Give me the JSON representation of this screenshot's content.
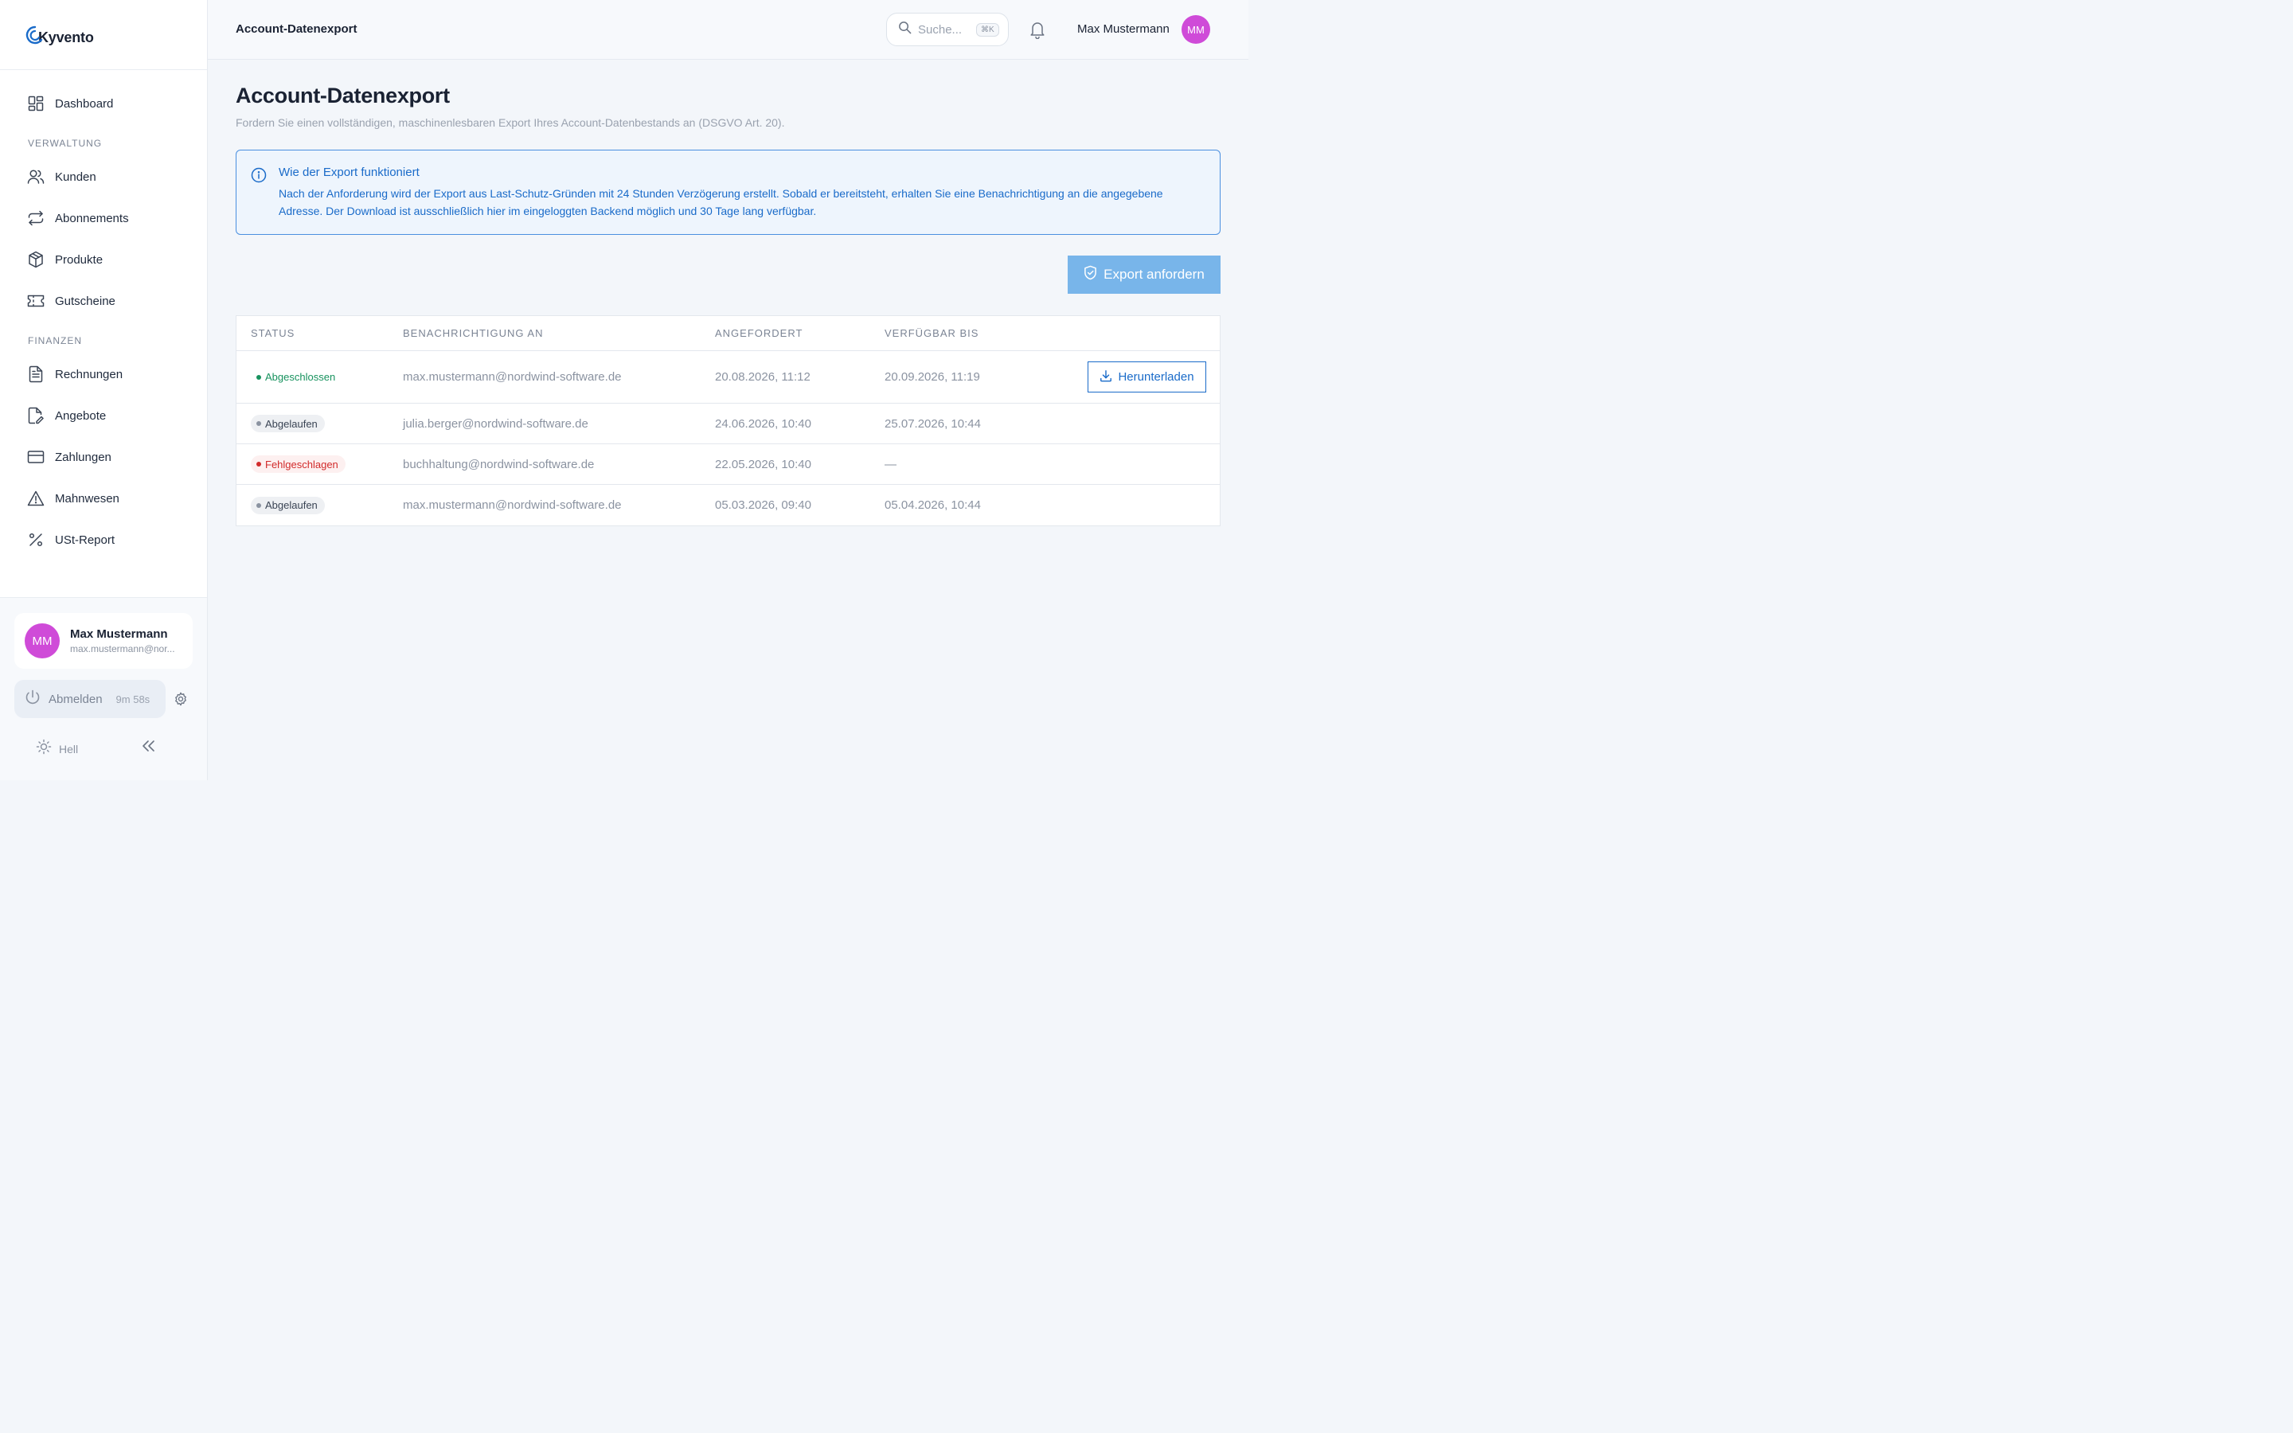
{
  "app": {
    "brand": "Kyvento"
  },
  "sidebar": {
    "dashboard": {
      "label": "Dashboard",
      "icon": "grid-icon"
    },
    "section_admin": "VERWALTUNG",
    "admin_items": [
      {
        "label": "Kunden",
        "icon": "users-icon"
      },
      {
        "label": "Abonnements",
        "icon": "repeat-icon"
      },
      {
        "label": "Produkte",
        "icon": "box-icon"
      },
      {
        "label": "Gutscheine",
        "icon": "ticket-icon"
      }
    ],
    "section_finance": "FINANZEN",
    "finance_items": [
      {
        "label": "Rechnungen",
        "icon": "file-text-icon"
      },
      {
        "label": "Angebote",
        "icon": "file-edit-icon"
      },
      {
        "label": "Zahlungen",
        "icon": "credit-card-icon"
      },
      {
        "label": "Mahnwesen",
        "icon": "alert-triangle-icon"
      },
      {
        "label": "USt-Report",
        "icon": "percent-icon"
      }
    ],
    "user": {
      "initials": "MM",
      "name": "Max Mustermann",
      "email": "max.mustermann@nor..."
    },
    "logout": {
      "label": "Abmelden",
      "timer": "9m 58s"
    },
    "theme": {
      "label": "Hell"
    }
  },
  "header": {
    "title": "Account-Datenexport",
    "search_placeholder": "Suche...",
    "search_shortcut": "⌘K",
    "user_name": "Max Mustermann",
    "user_initials": "MM"
  },
  "main": {
    "title": "Account-Datenexport",
    "subtitle": "Fordern Sie einen vollständigen, maschinenlesbaren Export Ihres Account-Datenbestands an (DSGVO Art. 20).",
    "info": {
      "title": "Wie der Export funktioniert",
      "text": "Nach der Anforderung wird der Export aus Last-Schutz-Gründen mit 24 Stunden Verzögerung erstellt. Sobald er bereitsteht, erhalten Sie eine Benachrichtigung an die angegebene Adresse. Der Download ist ausschließlich hier im eingeloggten Backend möglich und 30 Tage lang verfügbar."
    },
    "export_button": "Export anfordern",
    "table": {
      "columns": [
        "STATUS",
        "BENACHRICHTIGUNG AN",
        "ANGEFORDERT",
        "VERFÜGBAR BIS"
      ],
      "rows": [
        {
          "status": "Abgeschlossen",
          "status_type": "ok",
          "email": "max.mustermann@nordwind-software.de",
          "requested": "20.08.2026, 11:12",
          "available_until": "20.09.2026, 11:19",
          "action": "Herunterladen"
        },
        {
          "status": "Abgelaufen",
          "status_type": "expired",
          "email": "julia.berger@nordwind-software.de",
          "requested": "24.06.2026, 10:40",
          "available_until": "25.07.2026, 10:44",
          "action": ""
        },
        {
          "status": "Fehlgeschlagen",
          "status_type": "failed",
          "email": "buchhaltung@nordwind-software.de",
          "requested": "22.05.2026, 10:40",
          "available_until": "—",
          "action": ""
        },
        {
          "status": "Abgelaufen",
          "status_type": "expired",
          "email": "max.mustermann@nordwind-software.de",
          "requested": "05.03.2026, 09:40",
          "available_until": "05.04.2026, 10:44",
          "action": ""
        }
      ]
    }
  },
  "colors": {
    "accent": "#1a6bc9",
    "avatar": "#cf4bd8",
    "export_button": "#78b5ea",
    "success": "#17925e",
    "error": "#d22b2b"
  }
}
